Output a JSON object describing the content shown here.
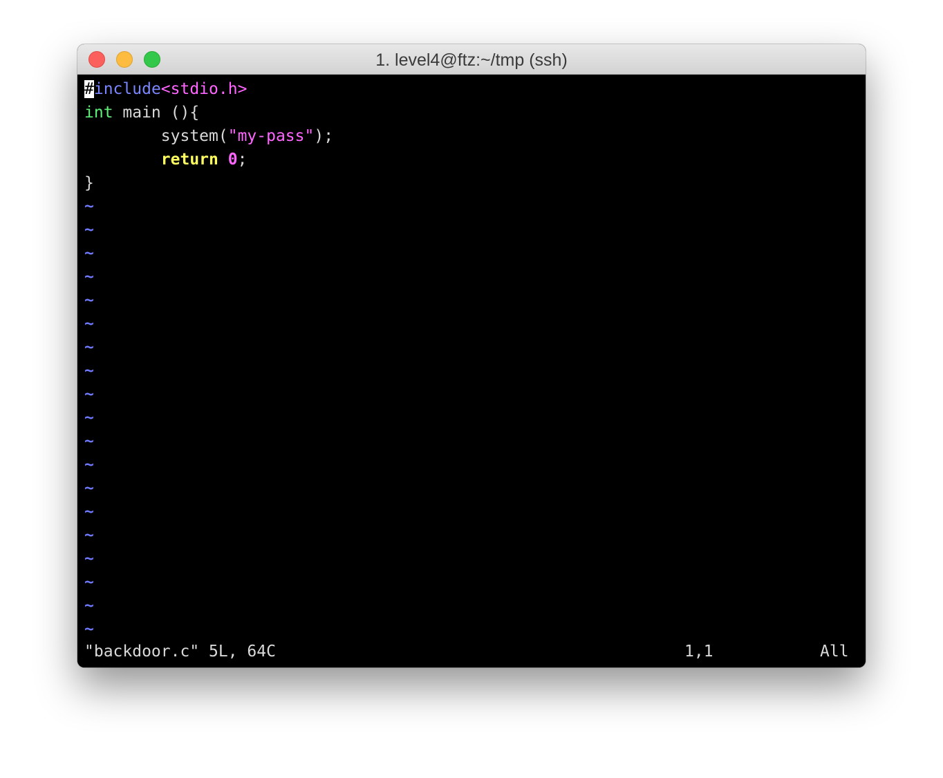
{
  "window": {
    "title": "1. level4@ftz:~/tmp (ssh)"
  },
  "editor": {
    "lines": [
      {
        "segments": [
          {
            "text": "#",
            "style": "cursor"
          },
          {
            "text": "include",
            "style": "preproc"
          },
          {
            "text": "<stdio.h>",
            "style": "include-file"
          }
        ]
      },
      {
        "segments": [
          {
            "text": "int",
            "style": "type"
          },
          {
            "text": " main (){",
            "style": "normal"
          }
        ]
      },
      {
        "segments": [
          {
            "text": "        system(",
            "style": "normal"
          },
          {
            "text": "\"my-pass\"",
            "style": "string"
          },
          {
            "text": ");",
            "style": "normal"
          }
        ]
      },
      {
        "segments": [
          {
            "text": "        ",
            "style": "normal"
          },
          {
            "text": "return",
            "style": "keyword"
          },
          {
            "text": " ",
            "style": "normal"
          },
          {
            "text": "0",
            "style": "number"
          },
          {
            "text": ";",
            "style": "normal"
          }
        ]
      },
      {
        "segments": [
          {
            "text": "}",
            "style": "normal"
          }
        ]
      }
    ],
    "empty_line_marker": "~",
    "empty_line_count": 19
  },
  "status_line": {
    "file_info": "\"backdoor.c\" 5L, 64C",
    "cursor_position": "1,1",
    "scroll_position": "All"
  },
  "colors": {
    "terminal_background": "#000000",
    "preproc": "#7a86ff",
    "include_file": "#ff66ff",
    "type": "#5ff07a",
    "string": "#ff66ff",
    "keyword": "#ffff5f",
    "number": "#ff66ff",
    "tilde": "#6f79ff",
    "close_button": "#fc605c",
    "minimize_button": "#fdbc40",
    "maximize_button": "#34c84a"
  }
}
